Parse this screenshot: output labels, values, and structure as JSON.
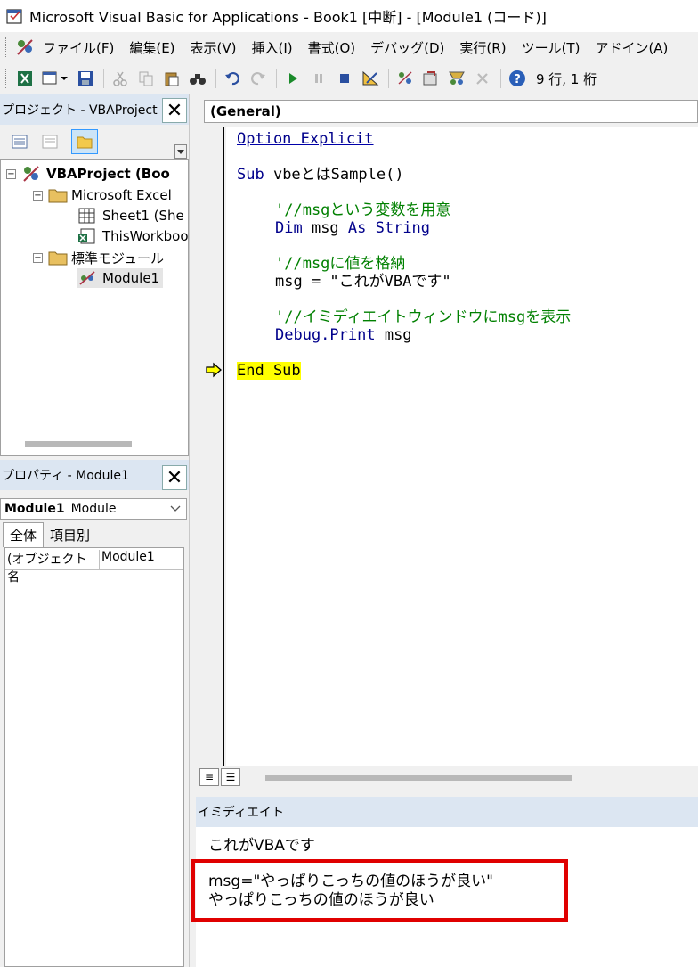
{
  "window": {
    "title": "Microsoft Visual Basic for Applications - Book1 [中断] - [Module1 (コード)]"
  },
  "menu": [
    "ファイル(F)",
    "編集(E)",
    "表示(V)",
    "挿入(I)",
    "書式(O)",
    "デバッグ(D)",
    "実行(R)",
    "ツール(T)",
    "アドイン(A)"
  ],
  "toolbar": {
    "cursor_position": "9 行, 1 桁"
  },
  "project_pane": {
    "title": "プロジェクト - VBAProject",
    "tree": [
      {
        "label": "VBAProject (Boo",
        "bold": true
      },
      {
        "label": "Microsoft Excel"
      },
      {
        "label": "Sheet1 (She"
      },
      {
        "label": "ThisWorkboo"
      },
      {
        "label": "標準モジュール"
      },
      {
        "label": "Module1"
      }
    ]
  },
  "properties_pane": {
    "title": "プロパティ - Module1",
    "object_name": "Module1",
    "object_type": "Module",
    "tabs": [
      "全体",
      "項目別"
    ],
    "rows": [
      {
        "name": "(オブジェクト名",
        "value": "Module1"
      }
    ]
  },
  "code_window": {
    "object_dropdown": "(General)",
    "lines": {
      "l1": "Option Explicit",
      "l2a": "Sub ",
      "l2b": "vbeとはSample()",
      "l3": "'//msgという変数を用意",
      "l4a": "Dim ",
      "l4b": "msg ",
      "l4c": "As String",
      "l5": "'//msgに値を格納",
      "l6": "msg = \"これがVBAです\"",
      "l7": "'//イミディエイトウィンドウにmsgを表示",
      "l8a": "Debug.Print ",
      "l8b": "msg",
      "l9": "End Sub"
    }
  },
  "immediate": {
    "title": "イミディエイト",
    "lines": [
      "これがVBAです",
      "msg=\"やっぱりこっちの値のほうが良い\"",
      "やっぱりこっちの値のほうが良い"
    ]
  },
  "colors": {
    "keyword": "#00008b",
    "comment": "#008000",
    "execution_highlight": "#ffff00",
    "annotation_box": "#e00000"
  }
}
